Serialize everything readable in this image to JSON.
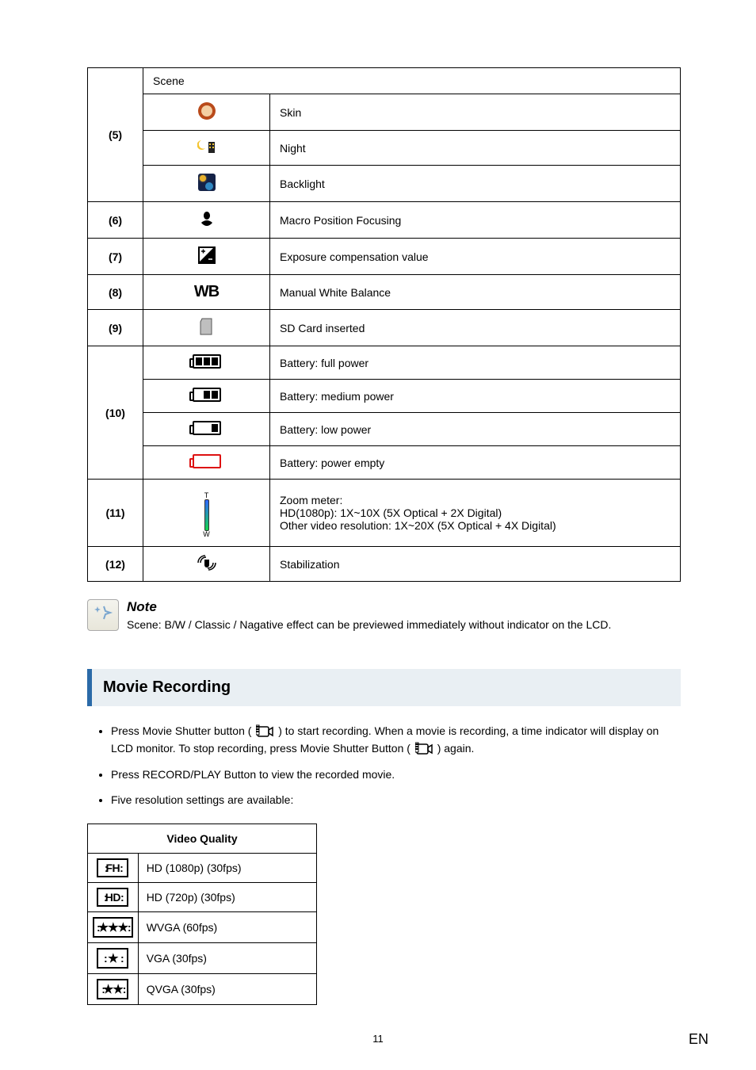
{
  "table": {
    "row5": {
      "idx": "(5)",
      "header": "Scene",
      "items": {
        "skin": "Skin",
        "night": "Night",
        "backlight": "Backlight"
      }
    },
    "row6": {
      "idx": "(6)",
      "desc": "Macro Position Focusing"
    },
    "row7": {
      "idx": "(7)",
      "desc": "Exposure compensation value"
    },
    "row8": {
      "idx": "(8)",
      "icon": "WB",
      "desc": "Manual White Balance"
    },
    "row9": {
      "idx": "(9)",
      "desc": "SD Card inserted"
    },
    "row10": {
      "idx": "(10)",
      "items": {
        "full": "Battery: full power",
        "medium": "Battery: medium power",
        "low": "Battery: low power",
        "empty": "Battery: power empty"
      }
    },
    "row11": {
      "idx": "(11)",
      "line1": "Zoom meter:",
      "line2": "HD(1080p): 1X~10X (5X Optical + 2X Digital)",
      "line3": "Other video resolution: 1X~20X (5X Optical + 4X Digital)"
    },
    "row12": {
      "idx": "(12)",
      "desc": "Stabilization"
    }
  },
  "note": {
    "title": "Note",
    "text": "Scene: B/W / Classic / Nagative effect can be previewed immediately without indicator on the LCD."
  },
  "section": {
    "title": "Movie Recording",
    "bullets": {
      "b1a": "Press Movie Shutter button (",
      "b1b": ") to start recording. When a movie is recording, a time indicator will display on LCD monitor. To stop recording, press Movie Shutter Button (",
      "b1c": ") again.",
      "b2": "Press RECORD/PLAY Button to view the recorded movie.",
      "b3": "Five resolution settings are available:"
    }
  },
  "quality": {
    "header": "Video Quality",
    "rows": {
      "fh": {
        "badge": "FH",
        "label": "HD (1080p) (30fps)"
      },
      "hd": {
        "badge": "HD",
        "label": "HD (720p) (30fps)"
      },
      "wvga": {
        "stars": "★★★",
        "label": "WVGA (60fps)"
      },
      "vga": {
        "stars": "★",
        "label": "VGA (30fps)"
      },
      "qvga": {
        "stars": "★★",
        "label": "QVGA (30fps)"
      }
    }
  },
  "page": {
    "num": "11",
    "lang": "EN"
  }
}
